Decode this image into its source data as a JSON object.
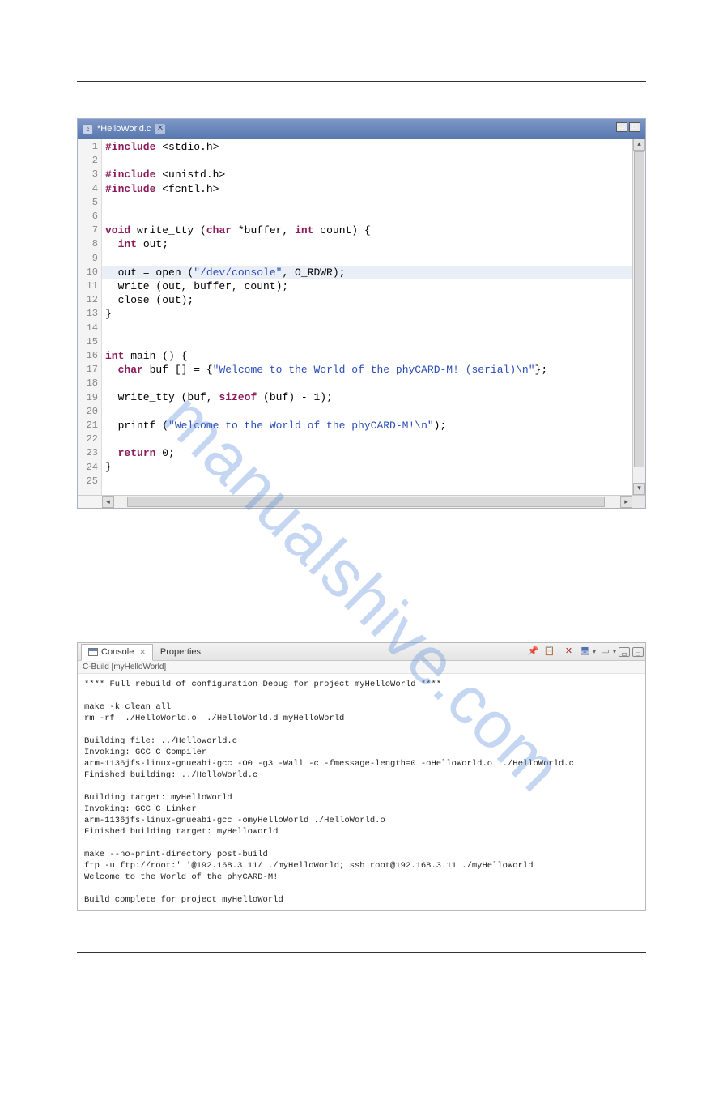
{
  "watermark": "manualshive.com",
  "editor": {
    "tab_title": "*HelloWorld.c",
    "highlighted_line": 10,
    "lines": [
      {
        "n": 1,
        "tokens": [
          [
            "kw",
            "#include"
          ],
          [
            "",
            " <stdio.h>"
          ]
        ]
      },
      {
        "n": 2,
        "tokens": []
      },
      {
        "n": 3,
        "tokens": [
          [
            "kw",
            "#include"
          ],
          [
            "",
            " <unistd.h>"
          ]
        ]
      },
      {
        "n": 4,
        "tokens": [
          [
            "kw",
            "#include"
          ],
          [
            "",
            " <fcntl.h>"
          ]
        ]
      },
      {
        "n": 5,
        "tokens": []
      },
      {
        "n": 6,
        "tokens": []
      },
      {
        "n": 7,
        "tokens": [
          [
            "kw",
            "void"
          ],
          [
            "",
            " write_tty ("
          ],
          [
            "kw",
            "char"
          ],
          [
            "",
            " *buffer, "
          ],
          [
            "kw",
            "int"
          ],
          [
            "",
            " count) {"
          ]
        ]
      },
      {
        "n": 8,
        "tokens": [
          [
            "",
            "  "
          ],
          [
            "kw",
            "int"
          ],
          [
            "",
            " out;"
          ]
        ]
      },
      {
        "n": 9,
        "tokens": []
      },
      {
        "n": 10,
        "tokens": [
          [
            "",
            "  out = open ("
          ],
          [
            "str",
            "\"/dev/console\""
          ],
          [
            "",
            ", O_RDWR);"
          ]
        ]
      },
      {
        "n": 11,
        "tokens": [
          [
            "",
            "  write (out, buffer, count);"
          ]
        ]
      },
      {
        "n": 12,
        "tokens": [
          [
            "",
            "  close (out);"
          ]
        ]
      },
      {
        "n": 13,
        "tokens": [
          [
            "",
            "}"
          ]
        ]
      },
      {
        "n": 14,
        "tokens": []
      },
      {
        "n": 15,
        "tokens": []
      },
      {
        "n": 16,
        "tokens": [
          [
            "kw",
            "int"
          ],
          [
            "",
            " main () {"
          ]
        ]
      },
      {
        "n": 17,
        "tokens": [
          [
            "",
            "  "
          ],
          [
            "kw",
            "char"
          ],
          [
            "",
            " buf [] = {"
          ],
          [
            "str",
            "\"Welcome to the World of the phyCARD-M! (serial)\\n\""
          ],
          [
            "",
            "};"
          ]
        ]
      },
      {
        "n": 18,
        "tokens": []
      },
      {
        "n": 19,
        "tokens": [
          [
            "",
            "  write_tty (buf, "
          ],
          [
            "kw",
            "sizeof"
          ],
          [
            "",
            " (buf) - 1);"
          ]
        ]
      },
      {
        "n": 20,
        "tokens": []
      },
      {
        "n": 21,
        "tokens": [
          [
            "",
            "  printf ("
          ],
          [
            "str",
            "\"Welcome to the World of the phyCARD-M!\\n\""
          ],
          [
            "",
            ");"
          ]
        ]
      },
      {
        "n": 22,
        "tokens": []
      },
      {
        "n": 23,
        "tokens": [
          [
            "",
            "  "
          ],
          [
            "kw",
            "return"
          ],
          [
            "",
            " 0;"
          ]
        ]
      },
      {
        "n": 24,
        "tokens": [
          [
            "",
            "}"
          ]
        ]
      },
      {
        "n": 25,
        "tokens": []
      }
    ]
  },
  "console": {
    "tabs": {
      "active": "Console",
      "other": "Properties"
    },
    "subtitle": "C-Build [myHelloWorld]",
    "toolbar_icons": {
      "pin": "📌",
      "clipboard": "📋",
      "clear": "✕",
      "monitor": "🖥",
      "page": "▭"
    },
    "win_min": "▭",
    "win_max": "□",
    "text": "**** Full rebuild of configuration Debug for project myHelloWorld ****\n\nmake -k clean all\nrm -rf  ./HelloWorld.o  ./HelloWorld.d myHelloWorld\n\nBuilding file: ../HelloWorld.c\nInvoking: GCC C Compiler\narm-1136jfs-linux-gnueabi-gcc -O0 -g3 -Wall -c -fmessage-length=0 -oHelloWorld.o ../HelloWorld.c\nFinished building: ../HelloWorld.c\n\nBuilding target: myHelloWorld\nInvoking: GCC C Linker\narm-1136jfs-linux-gnueabi-gcc -omyHelloWorld ./HelloWorld.o\nFinished building target: myHelloWorld\n\nmake --no-print-directory post-build\nftp -u ftp://root:' '@192.168.3.11/ ./myHelloWorld; ssh root@192.168.3.11 ./myHelloWorld\nWelcome to the World of the phyCARD-M!\n\nBuild complete for project myHelloWorld\n"
  }
}
